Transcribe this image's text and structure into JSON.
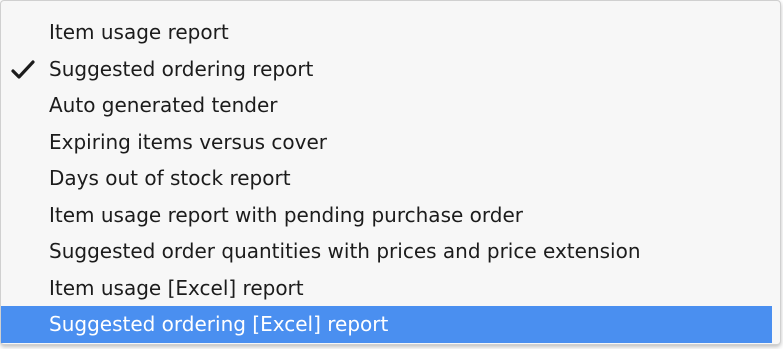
{
  "menu": {
    "items": [
      {
        "label": "Item usage report",
        "checked": false,
        "highlighted": false
      },
      {
        "label": "Suggested ordering report",
        "checked": true,
        "highlighted": false
      },
      {
        "label": "Auto generated tender",
        "checked": false,
        "highlighted": false
      },
      {
        "label": "Expiring items versus cover",
        "checked": false,
        "highlighted": false
      },
      {
        "label": "Days out of stock report",
        "checked": false,
        "highlighted": false
      },
      {
        "label": "Item usage report with pending purchase order",
        "checked": false,
        "highlighted": false
      },
      {
        "label": "Suggested order quantities with prices and price extension",
        "checked": false,
        "highlighted": false
      },
      {
        "label": "Item usage [Excel] report",
        "checked": false,
        "highlighted": false
      },
      {
        "label": "Suggested ordering [Excel] report",
        "checked": false,
        "highlighted": true
      }
    ],
    "check_icon": "checkmark-icon"
  },
  "colors": {
    "highlight": "#4a8ff0",
    "background": "#f7f7f7",
    "text": "#1c1c1c",
    "highlight_text": "#ffffff"
  }
}
